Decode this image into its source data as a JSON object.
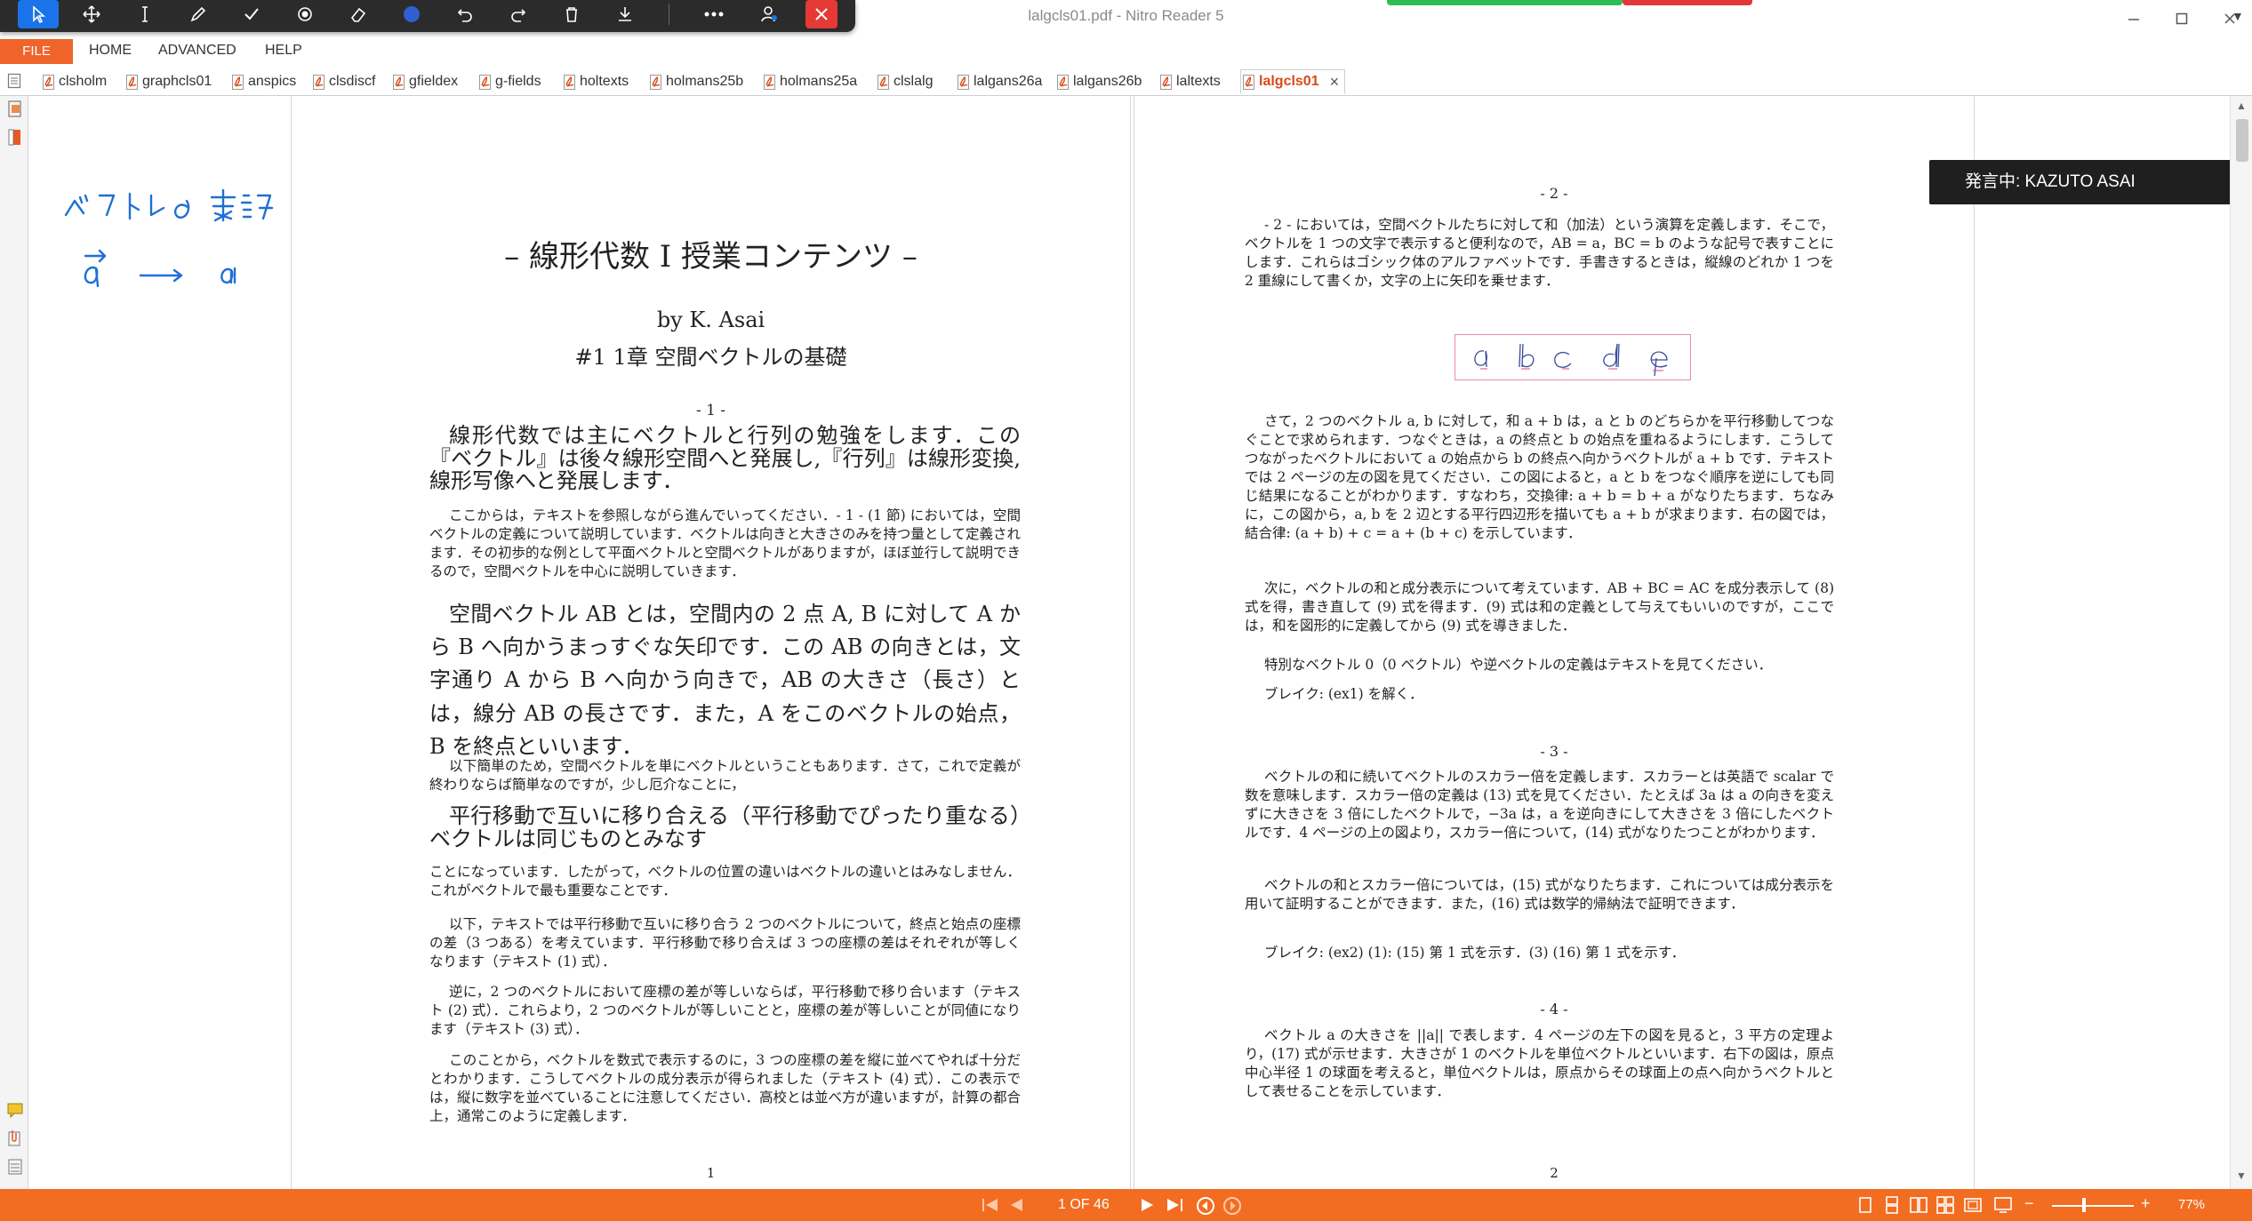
{
  "window": {
    "title": "lalgcls01.pdf - Nitro Reader 5"
  },
  "menu": {
    "file": "FILE",
    "home": "HOME",
    "advanced": "ADVANCED",
    "help": "HELP"
  },
  "tabs": [
    {
      "label": "clsholm"
    },
    {
      "label": "graphcls01"
    },
    {
      "label": "anspics"
    },
    {
      "label": "clsdiscf"
    },
    {
      "label": "gfieldex"
    },
    {
      "label": "g-fields"
    },
    {
      "label": "holtexts"
    },
    {
      "label": "holmans25b"
    },
    {
      "label": "holmans25a"
    },
    {
      "label": "clslalg"
    },
    {
      "label": "lalgans26a"
    },
    {
      "label": "lalgans26b"
    },
    {
      "label": "laltexts"
    },
    {
      "label": "lalgcls01"
    }
  ],
  "toast": {
    "text": "発言中: KAZUTO ASAI"
  },
  "page1": {
    "heading": "– 線形代数 I 授業コンテンツ –",
    "author": "by K. Asai",
    "chapter": "#1  1章  空間ベクトルの基礎",
    "section": "- 1 -",
    "p1": "線形代数では主にベクトルと行列の勉強をします．この『ベクトル』は後々線形空間へと発展し,『行列』は線形変換,線形写像へと発展します．",
    "p2": "ここからは，テキストを参照しながら進んでいってください．- 1 - (1 節) においては，空間ベクトルの定義について説明しています．ベクトルは向きと大きさのみを持つ量として定義されます．その初歩的な例として平面ベクトルと空間ベクトルがありますが，ほぼ並行して説明できるので，空間ベクトルを中心に説明していきます．",
    "p3": "空間ベクトル AB とは，空間内の 2 点 A, B に対して A から B へ向かうまっすぐな矢印です．この AB の向きとは，文字通り A から B へ向かう向きで，AB の大きさ（長さ）とは，線分 AB の長さです．また，A をこのベクトルの始点，B を終点といいます．",
    "p4": "以下簡単のため，空間ベクトルを単にベクトルということもあります．さて，これで定義が終わりならば簡単なのですが，少し厄介なことに，",
    "p5": "平行移動で互いに移り合える（平行移動でぴったり重なる）ベクトルは同じものとみなす",
    "p6": "ことになっています．したがって，ベクトルの位置の違いはベクトルの違いとはみなしません．これがベクトルで最も重要なことです．",
    "p7": "以下，テキストでは平行移動で互いに移り合う 2 つのベクトルについて，終点と始点の座標の差（3 つある）を考えています．平行移動で移り合えば 3 つの座標の差はそれぞれが等しくなります（テキスト (1) 式）．",
    "p8": "逆に，2 つのベクトルにおいて座標の差が等しいならば，平行移動で移り合います（テキスト (2) 式）．これらより，2 つのベクトルが等しいことと，座標の差が等しいことが同値になります（テキスト (3) 式）．",
    "p9": "このことから，ベクトルを数式で表示するのに，3 つの座標の差を縦に並べてやれば十分だとわかります．こうしてベクトルの成分表示が得られました（テキスト (4) 式）．この表示では，縦に数字を並べていることに注意してください．高校とは並べ方が違いますが，計算の都合上，通常このように定義します．",
    "pagenum": "1"
  },
  "page2": {
    "s2": "- 2 -",
    "q1": "- 2 - においては，空間ベクトルたちに対して和（加法）という演算を定義します．そこで，ベクトルを 1 つの文字で表示すると便利なので，AB = a，BC = b のような記号で表すことにします．これらはゴシック体のアルファベットです．手書きするときは，縦線のどれか 1 つを 2 重線にして書くか，文字の上に矢印を乗せます．",
    "q2": "さて，2 つのベクトル a, b に対して，和 a + b は，a と b のどちらかを平行移動してつなぐことで求められます．つなぐときは，a の終点と b の始点を重ねるようにします．こうしてつながったベクトルにおいて a の始点から b の終点へ向かうベクトルが a + b です．テキストでは 2 ページの左の図を見てください．この図によると，a と b をつなぐ順序を逆にしても同じ結果になることがわかります．すなわち，交換律: a + b = b + a がなりたちます．ちなみに，この図から，a, b を 2 辺とする平行四辺形を描いても a + b が求まります．右の図では，結合律: (a + b) + c = a + (b + c) を示しています．",
    "q3": "次に，ベクトルの和と成分表示について考えています．AB + BC = AC を成分表示して (8) 式を得，書き直して (9) 式を得ます．(9) 式は和の定義として与えてもいいのですが，ここでは，和を図形的に定義してから (9) 式を導きました．",
    "q4": "特別なベクトル 0（0 ベクトル）や逆ベクトルの定義はテキストを見てください．",
    "q5": "ブレイク: (ex1) を解く．",
    "s3": "- 3 -",
    "q6": "ベクトルの和に続いてベクトルのスカラー倍を定義します．スカラーとは英語で scalar で数を意味します．スカラー倍の定義は (13) 式を見てください．たとえば 3a は a の向きを変えずに大きさを 3 倍にしたベクトルで，−3a は，a を逆向きにして大きさを 3 倍にしたベクトルです．4 ページの上の図より，スカラー倍について，(14) 式がなりたつことがわかります．",
    "q7": "ベクトルの和とスカラー倍については，(15) 式がなりたちます．これについては成分表示を用いて証明することができます．また，(16) 式は数学的帰納法で証明できます．",
    "q8": "ブレイク: (ex2) (1): (15) 第 1 式を示す．(3) (16) 第 1 式を示す．",
    "s4": "- 4 -",
    "q9": "ベクトル a の大きさを ||a|| で表します．4 ページの左下の図を見ると，3 平方の定理より，(17) 式が示せます．大きさが 1 のベクトルを単位ベクトルといいます．右下の図は，原点中心半径 1 の球面を考えると，単位ベクトルは，原点からその球面上の点へ向かうベクトルとして表せることを示しています．",
    "pagenum": "2"
  },
  "status": {
    "page_indicator": "1 OF 46",
    "zoom": "77%"
  },
  "colors": {
    "accent": "#f26d21",
    "toolbar_bg": "#2b2b2b",
    "select_blue": "#1a73e8",
    "ink_blue": "#1f6fd6"
  }
}
